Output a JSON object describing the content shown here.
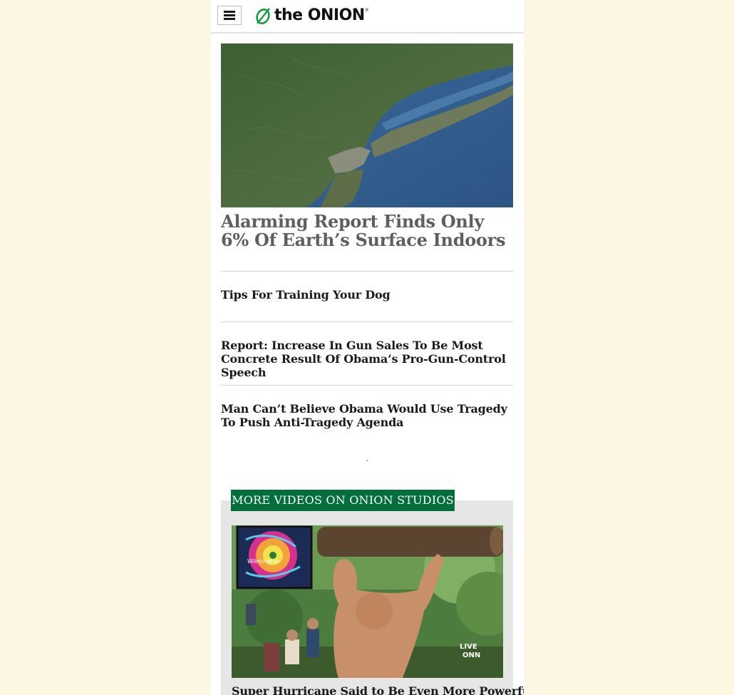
{
  "header": {
    "menu_icon": "hamburger-menu-icon",
    "logo_the": "the",
    "logo_onion": "ONION",
    "logo_reg": "®"
  },
  "hero": {
    "image_desc": "satellite-map",
    "title": "Alarming Report Finds Only 6% Of Earth’s Surface Indoors"
  },
  "stories": [
    {
      "title": "Tips For Training Your Dog"
    },
    {
      "title": "Report: Increase In Gun Sales To Be Most Concrete Result Of Obama’s Pro-Gun-Control Speech"
    },
    {
      "title": "Man Can’t Believe Obama Would Use Tragedy To Push Anti-Tragedy Agenda"
    }
  ],
  "videos": {
    "section_label": "MORE VIDEOS ON ONION STUDIOS",
    "thumb_inset_label": "Wilmington",
    "thumb_live_label": "LIVE",
    "thumb_network_label": "ONN",
    "video_title": "Super Hurricane Said to Be Even More Powerful"
  },
  "colors": {
    "page_background": "#fdf6e2",
    "brand_green": "#006f3c",
    "hero_title": "#5f5f5f"
  }
}
